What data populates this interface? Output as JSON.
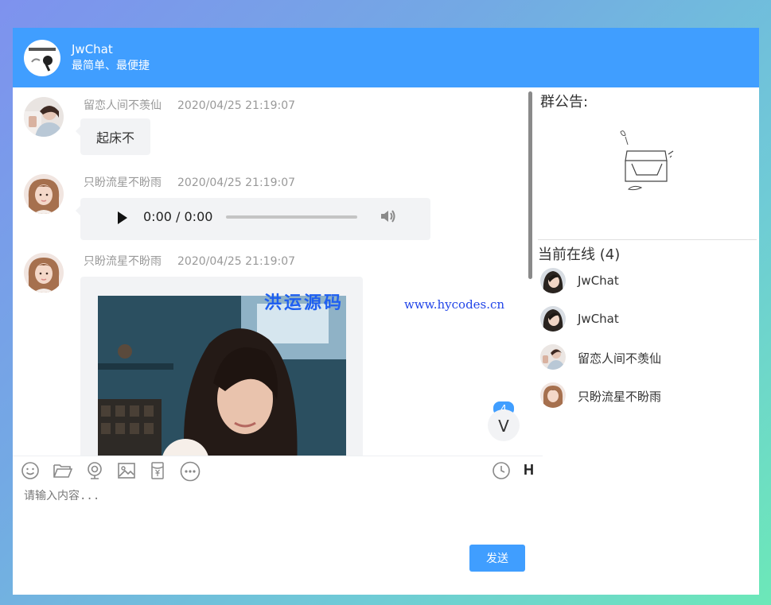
{
  "header": {
    "title": "JwChat",
    "subtitle": "最简单、最便捷"
  },
  "messages": [
    {
      "sender": "留恋人间不羡仙",
      "time": "2020/04/25 21:19:07",
      "type": "text",
      "text": "起床不"
    },
    {
      "sender": "只盼流星不盼雨",
      "time": "2020/04/25 21:19:07",
      "type": "audio",
      "audio_time": "0:00 / 0:00"
    },
    {
      "sender": "只盼流星不盼雨",
      "time": "2020/04/25 21:19:07",
      "type": "image"
    }
  ],
  "unread": {
    "count": "4",
    "arrow": "V"
  },
  "watermark": {
    "cn": "洪运源码",
    "en": "www.hycodes.cn"
  },
  "toolbar": {
    "tools": [
      "smile-icon",
      "folder-icon",
      "webcam-icon",
      "image-icon",
      "red-packet-icon",
      "more-icon"
    ],
    "right": [
      "history-icon"
    ],
    "h_label": "H"
  },
  "input": {
    "placeholder": "请输入内容...",
    "value": ""
  },
  "send_label": "发送",
  "sidebar": {
    "notice_title": "群公告:",
    "online_title": "当前在线 (4)",
    "users": [
      {
        "name": "JwChat"
      },
      {
        "name": "JwChat"
      },
      {
        "name": "留恋人间不羡仙"
      },
      {
        "name": "只盼流星不盼雨"
      }
    ]
  },
  "colors": {
    "primary": "#409eff",
    "bubble": "#f2f3f5",
    "meta_text": "#999999"
  }
}
